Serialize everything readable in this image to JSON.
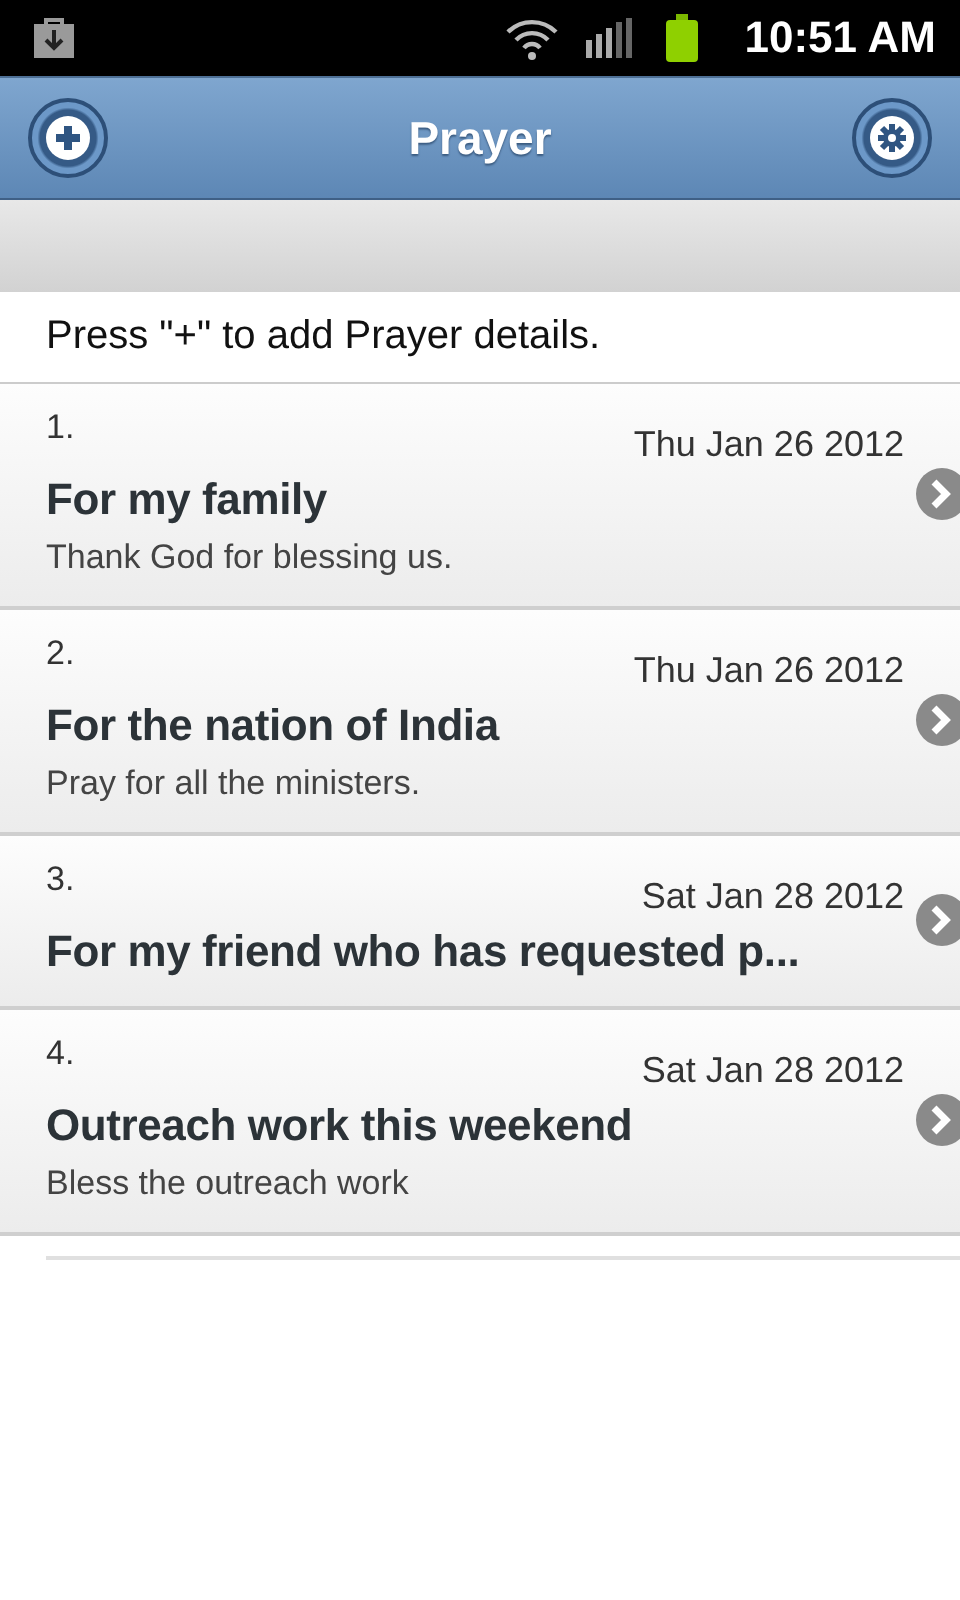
{
  "status_bar": {
    "time": "10:51 AM"
  },
  "header": {
    "title": "Prayer"
  },
  "hint": "Press \"+\" to add Prayer details.",
  "prayers": [
    {
      "number": "1.",
      "date": "Thu Jan 26 2012",
      "title": "For my family",
      "note": "Thank God for blessing us."
    },
    {
      "number": "2.",
      "date": "Thu Jan 26 2012",
      "title": "For the nation of India",
      "note": "Pray for all the ministers."
    },
    {
      "number": "3.",
      "date": "Sat Jan 28 2012",
      "title": "For my friend who has requested p..."
    },
    {
      "number": "4.",
      "date": "Sat Jan 28 2012",
      "title": "Outreach work this weekend",
      "note": "Bless the outreach work"
    }
  ]
}
